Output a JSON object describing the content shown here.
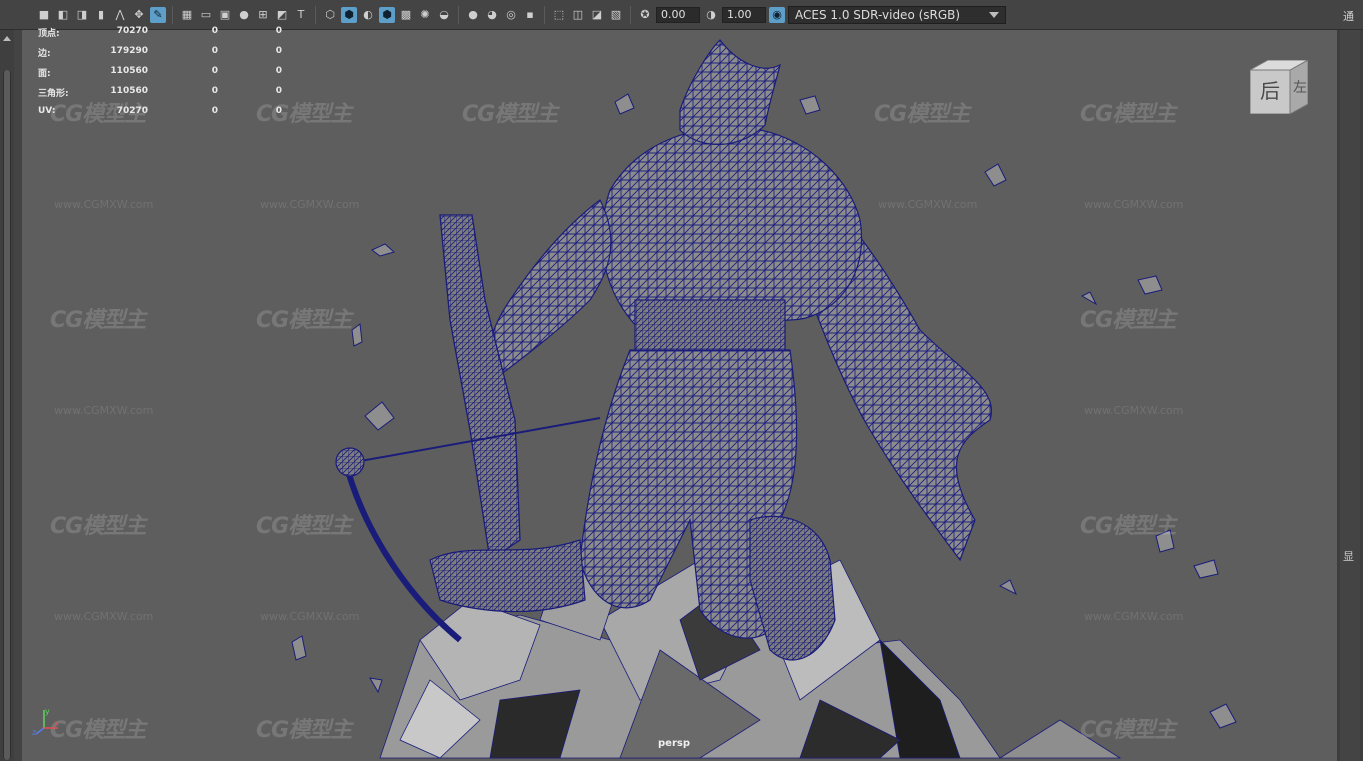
{
  "toolbar": {
    "exposure_value": "0.00",
    "gamma_value": "1.00",
    "color_management": "ACES 1.0 SDR-video (sRGB)",
    "icons": [
      "camera-select-icon",
      "camera-attr-icon",
      "bookmark-icon",
      "camera-icon",
      "image-plane-icon",
      "2d-pan-icon",
      "grease-pencil-icon",
      "grid-icon",
      "film-gate-icon",
      "resolution-gate-icon",
      "gate-mask-icon",
      "field-chart-icon",
      "safe-action-icon",
      "safe-title-icon",
      "wireframe-icon",
      "smooth-shade-icon",
      "wireframe-on-shaded-icon",
      "textured-icon",
      "use-all-lights-icon",
      "shadows-icon",
      "screen-space-ao-icon",
      "motion-blur-icon",
      "multisample-aa-icon",
      "depth-of-field-icon",
      "isolate-select-icon",
      "xray-icon",
      "xray-joints-icon",
      "backface-icon",
      "exposure-icon",
      "gamma-icon",
      "color-mgmt-toggle-icon"
    ]
  },
  "hud": {
    "rows": [
      {
        "label": "顶点:",
        "v1": "70270",
        "v2": "0",
        "v3": "0"
      },
      {
        "label": "边:",
        "v1": "179290",
        "v2": "0",
        "v3": "0"
      },
      {
        "label": "面:",
        "v1": "110560",
        "v2": "0",
        "v3": "0"
      },
      {
        "label": "三角形:",
        "v1": "110560",
        "v2": "0",
        "v3": "0"
      },
      {
        "label": "UV:",
        "v1": "70270",
        "v2": "0",
        "v3": "0"
      }
    ]
  },
  "viewport": {
    "camera_label": "persp",
    "viewcube_face": "后",
    "viewcube_side": "左",
    "axis": {
      "x": "x",
      "y": "y",
      "z": "z"
    }
  },
  "watermark": {
    "logo_text": "CG模型主",
    "url_text": "www.CGMXW.com"
  },
  "right_panel": {
    "glyph_top": "通",
    "glyph_mid": "显"
  },
  "colors": {
    "viewport_bg": "#5e5e5e",
    "wire": "#1a1c7a",
    "mesh_fill": "#8a8a8a",
    "accent": "#5d9fc8"
  }
}
